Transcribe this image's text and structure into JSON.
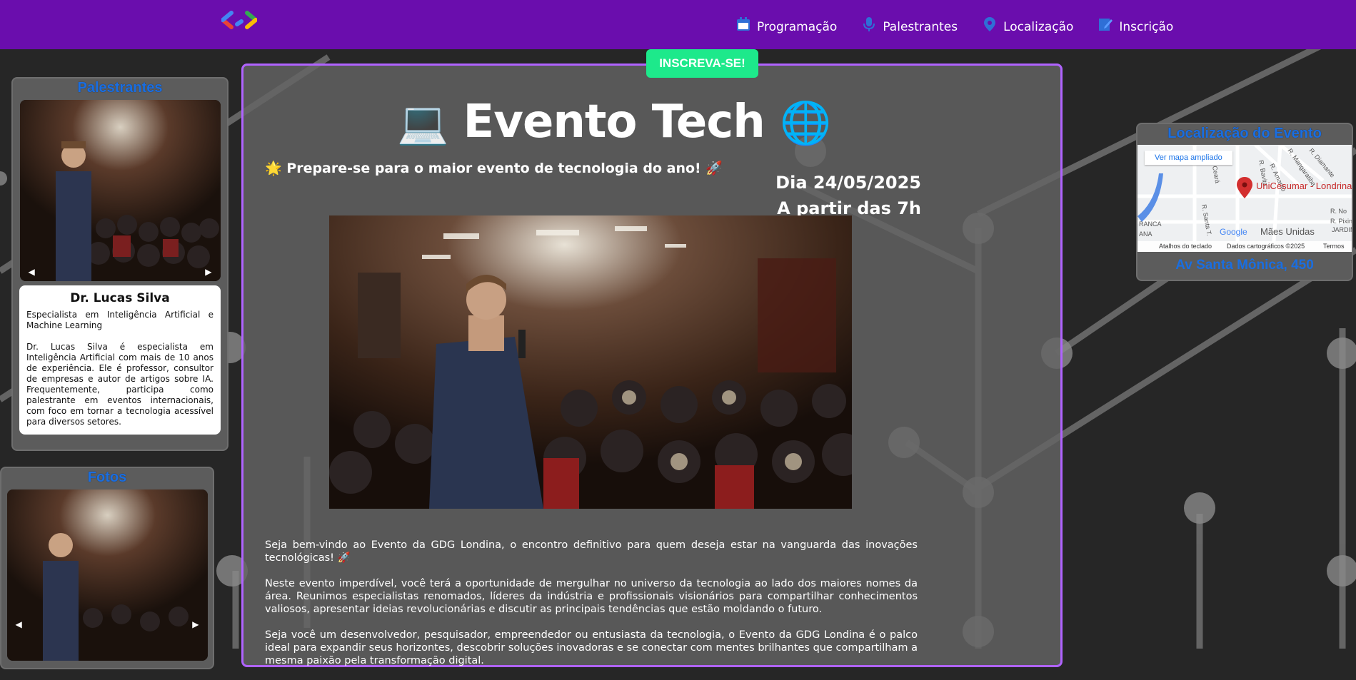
{
  "nav": {
    "items": [
      {
        "label": "Programação",
        "icon": "calendar-icon"
      },
      {
        "label": "Palestrantes",
        "icon": "microphone-icon"
      },
      {
        "label": "Localização",
        "icon": "location-pin-icon"
      },
      {
        "label": "Inscrição",
        "icon": "edit-form-icon"
      }
    ]
  },
  "cta": {
    "label": "INSCREVA-SE!"
  },
  "main": {
    "title": "Evento Tech",
    "title_emoji_left": "💻",
    "title_emoji_right": "🌐",
    "tagline": "🌟 Prepare-se para o maior evento de tecnologia do ano! 🚀",
    "date_line": "Dia 24/05/2025",
    "time_line": "A partir das 7h",
    "paragraphs": [
      "Seja bem-vindo ao Evento da GDG Londina, o encontro definitivo para quem deseja estar na vanguarda das inovações tecnológicas! 🚀",
      "Neste evento imperdível, você terá a oportunidade de mergulhar no universo da tecnologia ao lado dos maiores nomes da área. Reunimos especialistas renomados, líderes da indústria e profissionais visionários para compartilhar conhecimentos valiosos, apresentar ideias revolucionárias e discutir as principais tendências que estão moldando o futuro.",
      "Seja você um desenvolvedor, pesquisador, empreendedor ou entusiasta da tecnologia, o Evento da GDG Londina é o palco ideal para expandir seus horizontes, descobrir soluções inovadoras e se conectar com mentes brilhantes que compartilham a mesma paixão pela transformação digital."
    ]
  },
  "speakers": {
    "title": "Palestrantes",
    "name": "Dr. Lucas Silva",
    "role": "Especialista em Inteligência Artificial e Machine Learning",
    "bio": "Dr. Lucas Silva é especialista em Inteligência Artificial com mais de 10 anos de experiência. Ele é professor, consultor de empresas e autor de artigos sobre IA. Frequentemente, participa como palestrante em eventos internacionais, com foco em tornar a tecnologia acessível para diversos setores."
  },
  "photos": {
    "title": "Fotos"
  },
  "location": {
    "title": "Localização do Evento",
    "map_link": "Ver mapa ampliado",
    "pin_label": "UniCesumar - Londrina",
    "map_labels": [
      "R. Bavita",
      "R. Mangaratiba",
      "R. Diamante",
      "Ceará",
      "R. Amanto",
      "R. Santa T.",
      "R. No",
      "R. Pixinguinha",
      "JARDIM",
      "RANCA",
      "ANA",
      "Mães Unidas"
    ],
    "footer": {
      "shortcuts": "Atalhos do teclado",
      "data": "Dados cartográficos ©2025",
      "terms": "Termos"
    },
    "address": "Av Santa Mônica, 450"
  },
  "colors": {
    "topbar": "#6a0dad",
    "cta": "#1de98b",
    "accent_border": "#b063ff",
    "panel_title": "#1a6ee0"
  }
}
